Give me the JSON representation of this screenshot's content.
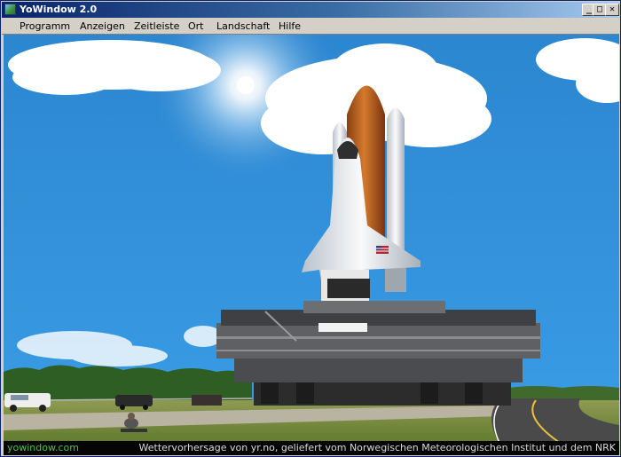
{
  "window": {
    "title": "YoWindow 2.0",
    "controls": {
      "minimize": "_",
      "maximize": "□",
      "close": "✕"
    }
  },
  "menu": {
    "items": [
      {
        "label": "Programm"
      },
      {
        "label": "Anzeigen"
      },
      {
        "label": "Zeitleiste"
      },
      {
        "label": "Ort"
      },
      {
        "label": "Landschaft"
      },
      {
        "label": "Hilfe"
      }
    ]
  },
  "scene": {
    "landscape": "space-shuttle-launch-pad",
    "sky_color": "#2f8fd7",
    "shuttle_flag": "us-flag-icon"
  },
  "status": {
    "website": "yowindow.com",
    "credit": "Wettervorhersage von yr.no, geliefert vom Norwegischen Meteorologischen Institut und dem NRK"
  }
}
